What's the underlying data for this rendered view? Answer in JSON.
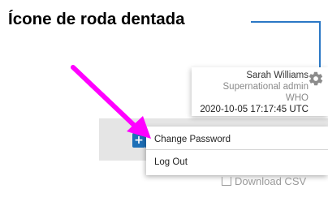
{
  "annotation": {
    "label": "Ícone de roda dentada",
    "line_color": "#2b78c5",
    "arrow_color": "#ff00ff"
  },
  "user": {
    "name": "Sarah Williams",
    "role": "Supernational admin",
    "org": "WHO",
    "timestamp": "2020-10-05 17:17:45 UTC",
    "gear_icon": "gear-icon"
  },
  "menu": {
    "items": [
      {
        "label": "Change Password"
      },
      {
        "label": "Log Out"
      }
    ]
  },
  "toolbar": {
    "add_button_icon": "+",
    "download_label": "Download CSV",
    "download_icon": "download-icon",
    "accent": "#1d6fb7"
  }
}
